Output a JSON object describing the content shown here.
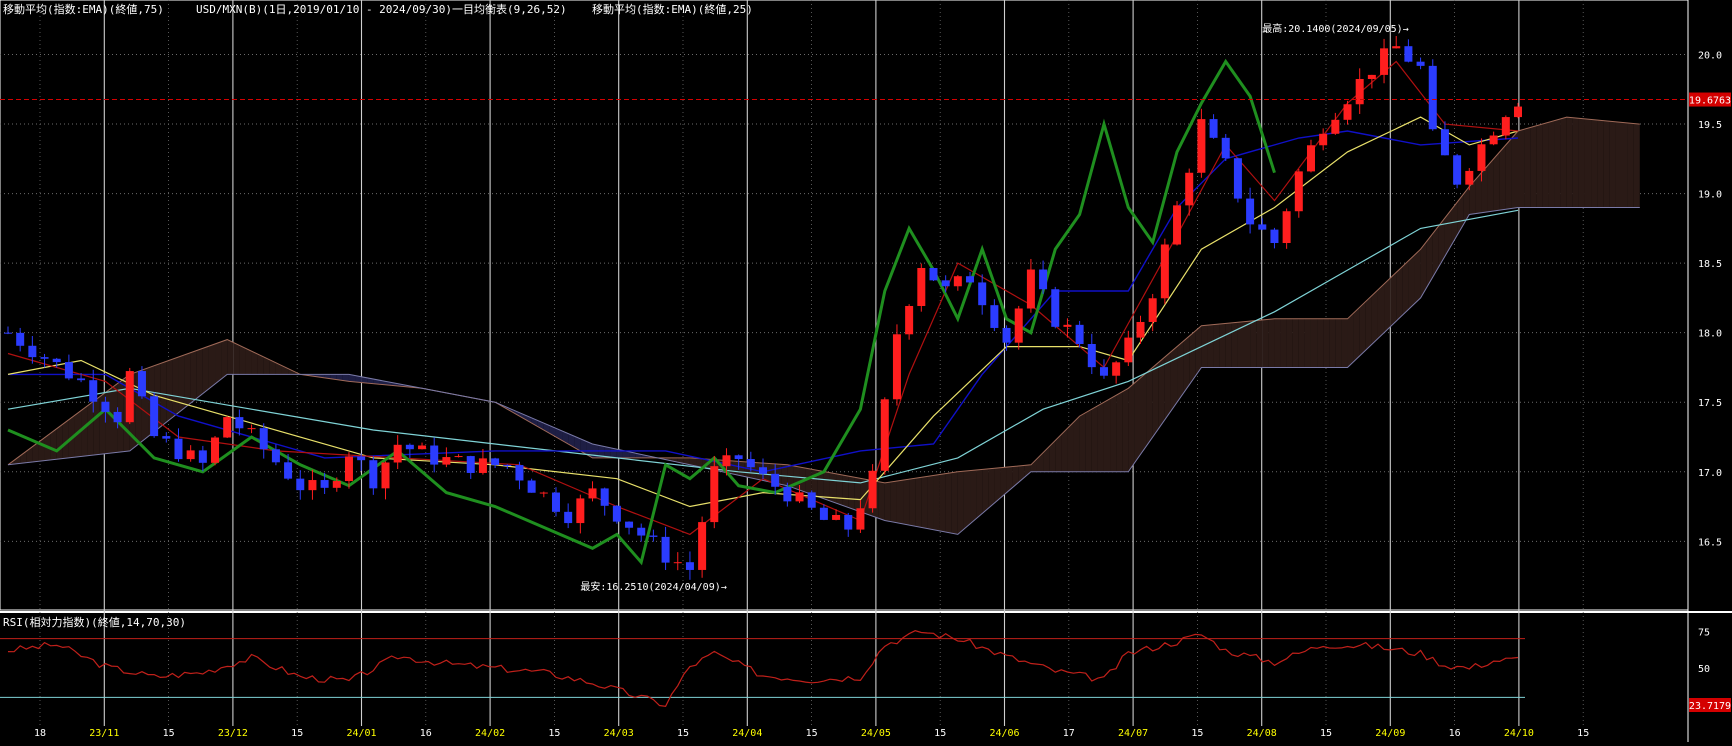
{
  "header": {
    "ema75": "移動平均(指数:EMA)(終値,75)",
    "symbol": "USD/MXN(B)(1日,2019/01/10 - 2024/09/30)",
    "ichimoku": "一目均衡表(9,26,52)",
    "ema25": "移動平均(指数:EMA)(終値,25)"
  },
  "rsi_header": "RSI(相対力指数)(終値,14,70,30)",
  "colors": {
    "background": "#000000",
    "grid": "#6b6b6b",
    "month_grid": "#cfcfcf",
    "up_candle": "#ff1e1e",
    "down_candle": "#2b3cff",
    "ema75": "#7fd3d6",
    "ema25": "#e8e06a",
    "kijun": "#1010c8",
    "tenkan": "#b01010",
    "chikou": "#1f8f1f",
    "kumo_bull": "#2a1a16",
    "kumo_bear": "#1e1e44",
    "last_price_box": "#d40000",
    "rsi_line": "#c0201a",
    "rsi_level_line": "#c0201a",
    "rsi_30_line": "#7fd3d6"
  },
  "chart_data": [
    {
      "type": "candlestick",
      "title": "USD/MXN(B)",
      "y_ticks": [
        "20.0",
        "19.5",
        "19.0",
        "18.5",
        "18.0",
        "17.5",
        "17.0",
        "16.5"
      ],
      "ylim": [
        16.15,
        20.32
      ],
      "x_ticks": [
        "18",
        "23/11",
        "15",
        "23/12",
        "15",
        "24/01",
        "16",
        "24/02",
        "15",
        "24/03",
        "15",
        "24/04",
        "15",
        "24/05",
        "15",
        "24/06",
        "17",
        "24/07",
        "15",
        "24/08",
        "15",
        "24/09",
        "16",
        "24/10",
        "15"
      ],
      "month_labels": [
        "23/11",
        "23/12",
        "24/01",
        "24/02",
        "24/03",
        "24/04",
        "24/05",
        "24/06",
        "24/07",
        "24/08",
        "24/09",
        "24/10"
      ],
      "last_price": "19.6763",
      "high_annotation": "最高:20.1400(2024/09/05)→",
      "low_annotation": "最安:16.2510(2024/04/09)→",
      "close_path": [
        [
          0,
          18.0
        ],
        [
          6,
          17.65
        ],
        [
          9,
          17.4
        ],
        [
          10,
          17.7
        ],
        [
          12,
          17.25
        ],
        [
          16,
          17.05
        ],
        [
          18,
          17.4
        ],
        [
          20,
          17.25
        ],
        [
          24,
          16.9
        ],
        [
          26,
          16.85
        ],
        [
          28,
          17.15
        ],
        [
          30,
          16.95
        ],
        [
          32,
          17.2
        ],
        [
          35,
          17.1
        ],
        [
          38,
          17.05
        ],
        [
          41,
          17.05
        ],
        [
          43,
          16.9
        ],
        [
          46,
          16.7
        ],
        [
          48,
          16.85
        ],
        [
          50,
          16.7
        ],
        [
          52,
          16.55
        ],
        [
          54,
          16.4
        ],
        [
          56,
          16.3
        ],
        [
          58,
          17.0
        ],
        [
          60,
          17.1
        ],
        [
          62,
          16.95
        ],
        [
          64,
          16.85
        ],
        [
          67,
          16.65
        ],
        [
          69,
          16.6
        ],
        [
          71,
          16.95
        ],
        [
          73,
          18.0
        ],
        [
          75,
          18.5
        ],
        [
          77,
          18.3
        ],
        [
          79,
          18.4
        ],
        [
          82,
          17.95
        ],
        [
          84,
          18.4
        ],
        [
          86,
          18.1
        ],
        [
          88,
          17.95
        ],
        [
          90,
          17.65
        ],
        [
          92,
          17.9
        ],
        [
          94,
          18.3
        ],
        [
          96,
          18.9
        ],
        [
          98,
          19.5
        ],
        [
          100,
          19.2
        ],
        [
          102,
          18.8
        ],
        [
          104,
          18.65
        ],
        [
          106,
          19.15
        ],
        [
          108,
          19.5
        ],
        [
          110,
          19.7
        ],
        [
          112,
          19.9
        ],
        [
          114,
          20.05
        ],
        [
          116,
          19.9
        ],
        [
          117,
          19.4
        ],
        [
          119,
          19.1
        ],
        [
          121,
          19.35
        ],
        [
          123,
          19.6
        ],
        [
          124,
          19.68
        ]
      ],
      "ema25_path": [
        [
          0,
          17.7
        ],
        [
          6,
          17.8
        ],
        [
          12,
          17.55
        ],
        [
          20,
          17.35
        ],
        [
          30,
          17.1
        ],
        [
          40,
          17.05
        ],
        [
          50,
          16.95
        ],
        [
          56,
          16.75
        ],
        [
          62,
          16.85
        ],
        [
          70,
          16.8
        ],
        [
          76,
          17.4
        ],
        [
          82,
          17.9
        ],
        [
          88,
          17.9
        ],
        [
          92,
          17.8
        ],
        [
          98,
          18.6
        ],
        [
          104,
          18.9
        ],
        [
          110,
          19.3
        ],
        [
          116,
          19.55
        ],
        [
          120,
          19.35
        ],
        [
          124,
          19.45
        ]
      ],
      "ema75_path": [
        [
          0,
          17.45
        ],
        [
          10,
          17.6
        ],
        [
          20,
          17.45
        ],
        [
          30,
          17.3
        ],
        [
          40,
          17.2
        ],
        [
          50,
          17.1
        ],
        [
          60,
          17.0
        ],
        [
          70,
          16.92
        ],
        [
          78,
          17.1
        ],
        [
          85,
          17.45
        ],
        [
          92,
          17.65
        ],
        [
          98,
          17.9
        ],
        [
          104,
          18.15
        ],
        [
          110,
          18.45
        ],
        [
          116,
          18.75
        ],
        [
          124,
          18.88
        ]
      ],
      "kijun_path": [
        [
          0,
          17.7
        ],
        [
          8,
          17.7
        ],
        [
          14,
          17.4
        ],
        [
          26,
          17.1
        ],
        [
          40,
          17.15
        ],
        [
          54,
          17.15
        ],
        [
          62,
          17.0
        ],
        [
          70,
          17.15
        ],
        [
          76,
          17.2
        ],
        [
          80,
          17.7
        ],
        [
          86,
          18.3
        ],
        [
          92,
          18.3
        ],
        [
          96,
          18.9
        ],
        [
          100,
          19.25
        ],
        [
          106,
          19.4
        ],
        [
          110,
          19.45
        ],
        [
          116,
          19.35
        ],
        [
          124,
          19.4
        ]
      ],
      "tenkan_path": [
        [
          0,
          17.85
        ],
        [
          8,
          17.65
        ],
        [
          14,
          17.25
        ],
        [
          22,
          17.15
        ],
        [
          32,
          17.1
        ],
        [
          42,
          17.05
        ],
        [
          50,
          16.75
        ],
        [
          56,
          16.55
        ],
        [
          62,
          16.95
        ],
        [
          70,
          16.65
        ],
        [
          74,
          17.7
        ],
        [
          78,
          18.5
        ],
        [
          84,
          18.2
        ],
        [
          90,
          17.75
        ],
        [
          96,
          18.7
        ],
        [
          100,
          19.35
        ],
        [
          104,
          18.95
        ],
        [
          110,
          19.65
        ],
        [
          114,
          19.95
        ],
        [
          118,
          19.5
        ],
        [
          124,
          19.45
        ]
      ],
      "chikou_path": [
        [
          0,
          17.3
        ],
        [
          4,
          17.15
        ],
        [
          8,
          17.45
        ],
        [
          12,
          17.1
        ],
        [
          16,
          17.0
        ],
        [
          20,
          17.25
        ],
        [
          24,
          17.05
        ],
        [
          28,
          16.9
        ],
        [
          32,
          17.15
        ],
        [
          36,
          16.85
        ],
        [
          40,
          16.75
        ],
        [
          44,
          16.6
        ],
        [
          48,
          16.45
        ],
        [
          50,
          16.55
        ],
        [
          52,
          16.35
        ],
        [
          54,
          17.05
        ],
        [
          56,
          16.95
        ],
        [
          58,
          17.1
        ],
        [
          60,
          16.9
        ],
        [
          63,
          16.85
        ],
        [
          67,
          17.0
        ],
        [
          70,
          17.45
        ],
        [
          72,
          18.3
        ],
        [
          74,
          18.75
        ],
        [
          76,
          18.45
        ],
        [
          78,
          18.1
        ],
        [
          80,
          18.6
        ],
        [
          82,
          18.1
        ],
        [
          84,
          18.0
        ],
        [
          86,
          18.6
        ],
        [
          88,
          18.85
        ],
        [
          90,
          19.5
        ],
        [
          92,
          18.9
        ],
        [
          94,
          18.65
        ],
        [
          96,
          19.3
        ],
        [
          98,
          19.65
        ],
        [
          100,
          19.95
        ],
        [
          102,
          19.7
        ],
        [
          104,
          19.15
        ]
      ],
      "kumo_a_path": [
        [
          0,
          17.05
        ],
        [
          10,
          17.7
        ],
        [
          18,
          17.95
        ],
        [
          24,
          17.7
        ],
        [
          28,
          17.65
        ],
        [
          34,
          17.6
        ],
        [
          40,
          17.5
        ],
        [
          48,
          17.1
        ],
        [
          56,
          17.1
        ],
        [
          64,
          17.05
        ],
        [
          72,
          16.92
        ],
        [
          78,
          17.0
        ],
        [
          84,
          17.05
        ],
        [
          88,
          17.4
        ],
        [
          92,
          17.6
        ],
        [
          98,
          18.05
        ],
        [
          104,
          18.1
        ],
        [
          110,
          18.1
        ],
        [
          116,
          18.6
        ],
        [
          120,
          19.05
        ],
        [
          124,
          19.45
        ],
        [
          128,
          19.55
        ],
        [
          134,
          19.5
        ]
      ],
      "kumo_b_path": [
        [
          0,
          17.05
        ],
        [
          10,
          17.15
        ],
        [
          18,
          17.7
        ],
        [
          24,
          17.7
        ],
        [
          28,
          17.7
        ],
        [
          34,
          17.6
        ],
        [
          40,
          17.5
        ],
        [
          48,
          17.2
        ],
        [
          56,
          17.05
        ],
        [
          64,
          16.9
        ],
        [
          72,
          16.65
        ],
        [
          78,
          16.55
        ],
        [
          84,
          17.0
        ],
        [
          88,
          17.0
        ],
        [
          92,
          17.0
        ],
        [
          98,
          17.75
        ],
        [
          104,
          17.75
        ],
        [
          110,
          17.75
        ],
        [
          116,
          18.25
        ],
        [
          120,
          18.85
        ],
        [
          124,
          18.9
        ],
        [
          128,
          18.9
        ],
        [
          134,
          18.9
        ]
      ]
    },
    {
      "type": "line",
      "title": "RSI",
      "y_ticks": [
        "75",
        "50",
        "25"
      ],
      "ylim": [
        20,
        80
      ],
      "levels": [
        70,
        30
      ],
      "last_value": "23.7179",
      "values_path": [
        [
          0,
          62
        ],
        [
          4,
          66
        ],
        [
          8,
          51
        ],
        [
          12,
          44
        ],
        [
          16,
          47
        ],
        [
          20,
          57
        ],
        [
          24,
          44
        ],
        [
          28,
          41
        ],
        [
          32,
          58
        ],
        [
          36,
          53
        ],
        [
          40,
          50
        ],
        [
          44,
          47
        ],
        [
          48,
          40
        ],
        [
          52,
          30
        ],
        [
          54,
          25
        ],
        [
          56,
          51
        ],
        [
          58,
          60
        ],
        [
          62,
          45
        ],
        [
          66,
          42
        ],
        [
          70,
          44
        ],
        [
          72,
          66
        ],
        [
          75,
          75
        ],
        [
          78,
          70
        ],
        [
          82,
          58
        ],
        [
          86,
          48
        ],
        [
          90,
          42
        ],
        [
          92,
          60
        ],
        [
          96,
          68
        ],
        [
          98,
          73
        ],
        [
          100,
          62
        ],
        [
          104,
          54
        ],
        [
          108,
          66
        ],
        [
          112,
          65
        ],
        [
          116,
          60
        ],
        [
          118,
          52
        ],
        [
          120,
          50
        ],
        [
          122,
          55
        ],
        [
          124,
          56
        ]
      ]
    }
  ]
}
